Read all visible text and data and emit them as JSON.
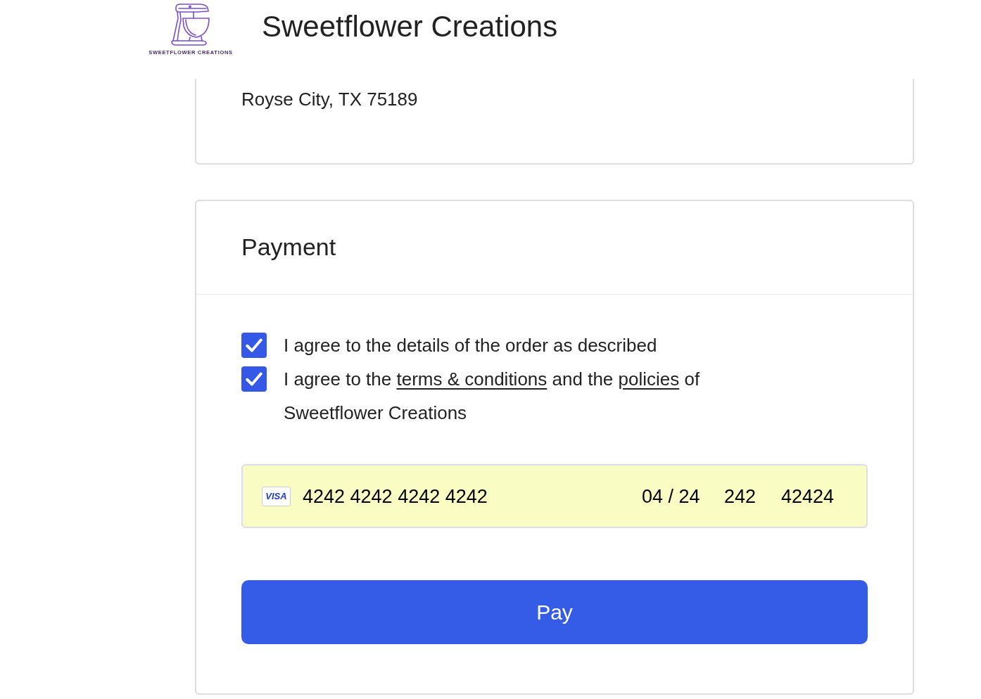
{
  "header": {
    "logo_text": "SWEETFLOWER CREATIONS",
    "title": "Sweetflower Creations"
  },
  "address_card": {
    "lines": [
      "Royse City, TX 75189"
    ]
  },
  "payment": {
    "title": "Payment",
    "agreements": [
      {
        "checked": true,
        "parts": [
          {
            "kind": "text",
            "text": "I agree to the details of the order as described"
          }
        ]
      },
      {
        "checked": true,
        "parts": [
          {
            "kind": "text",
            "text": "I agree to the "
          },
          {
            "kind": "link",
            "text": "terms & conditions"
          },
          {
            "kind": "text",
            "text": " and the "
          },
          {
            "kind": "link",
            "text": "policies"
          },
          {
            "kind": "text",
            "text": " of Sweetflower Creations"
          }
        ]
      }
    ],
    "card": {
      "brand": "VISA",
      "number": "4242 4242 4242 4242",
      "expiry": "04 / 24",
      "cvc": "242",
      "zip": "42424"
    },
    "pay_button": "Pay"
  }
}
